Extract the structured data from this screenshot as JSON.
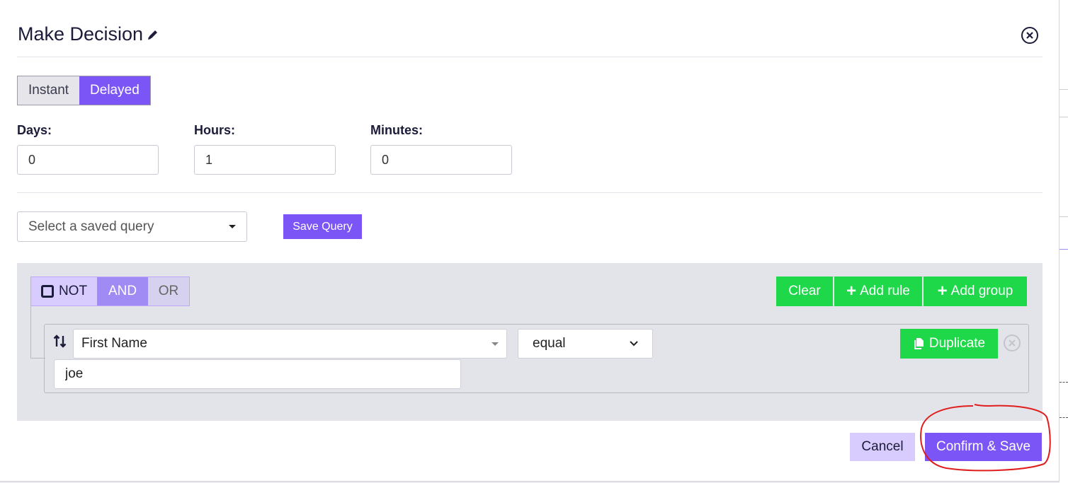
{
  "modal": {
    "title": "Make Decision",
    "timing_tabs": [
      {
        "label": "Instant",
        "active": false
      },
      {
        "label": "Delayed",
        "active": true
      }
    ],
    "delay": {
      "days_label": "Days:",
      "days_value": "0",
      "hours_label": "Hours:",
      "hours_value": "1",
      "minutes_label": "Minutes:",
      "minutes_value": "0"
    },
    "saved_query": {
      "placeholder": "Select a saved query",
      "save_button": "Save Query"
    },
    "query_builder": {
      "logic": {
        "not_label": "NOT",
        "and_label": "AND",
        "or_label": "OR",
        "selected": "AND"
      },
      "actions": {
        "clear_label": "Clear",
        "add_rule_label": "Add rule",
        "add_group_label": "Add group"
      },
      "rule": {
        "field": "First Name",
        "operator": "equal",
        "value": "joe",
        "duplicate_label": "Duplicate"
      }
    },
    "footer": {
      "cancel_label": "Cancel",
      "confirm_label": "Confirm & Save"
    }
  },
  "colors": {
    "accent": "#7c55f6",
    "green": "#1ed84a",
    "annotation_red": "#e01e1e"
  },
  "icons": [
    "pencil-icon",
    "close-circle-icon",
    "checkbox-icon",
    "plus-icon",
    "sort-icon",
    "copy-icon",
    "remove-circle-icon",
    "caret-down-icon"
  ]
}
